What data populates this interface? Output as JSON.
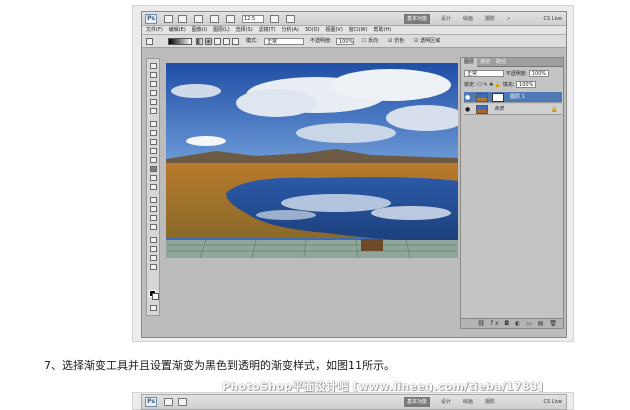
{
  "figure1": {
    "app_logo": "Ps",
    "zoom": "12.5",
    "workspaces": [
      "基本功能",
      "设计",
      "绘画",
      "摄影"
    ],
    "workspace_more": "»",
    "cs_live": "CS Live",
    "menu": [
      "文件(F)",
      "编辑(E)",
      "图像(I)",
      "图层(L)",
      "选择(S)",
      "滤镜(T)",
      "分析(A)",
      "3D(D)",
      "视图(V)",
      "窗口(W)",
      "帮助(H)"
    ],
    "options": {
      "mode_label": "模式:",
      "mode_value": "正常",
      "opacity_label": "不透明度:",
      "opacity_value": "100%",
      "reverse": "反向",
      "dither": "仿色",
      "transparency": "透明区域"
    },
    "layers_panel": {
      "tabs": [
        "图层",
        "通道",
        "路径"
      ],
      "blend_mode": "正常",
      "opacity_label": "不透明度:",
      "opacity_value": "100%",
      "lock_label": "锁定:",
      "fill_label": "填充:",
      "fill_value": "100%",
      "layers": [
        {
          "name": "图层 1",
          "selected": true,
          "has_mask": true
        },
        {
          "name": "背景",
          "selected": false,
          "has_mask": false
        }
      ],
      "bottom_icons": "⛓ fx ◘ ◐ ▭ ▤ 🗑"
    },
    "canvas_icon": "landscape-photo"
  },
  "caption": "7、选择渐变工具并且设置渐变为黑色到透明的渐变样式，如图11所示。",
  "watermark": "PhotoShop平面设计吧 [www.lineeg.com/tieba/1783]",
  "figure2": {
    "app_logo": "Ps",
    "workspaces": [
      "基本功能",
      "设计",
      "绘画",
      "摄影"
    ],
    "cs_live": "CS Live"
  }
}
